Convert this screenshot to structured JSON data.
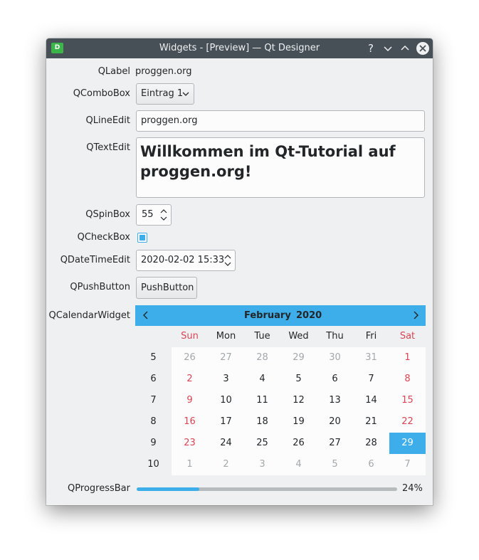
{
  "window": {
    "title": "Widgets - [Preview] — Qt Designer",
    "app_icon_letter": "D",
    "help_glyph": "?",
    "minimize_glyph": "chevron-down-icon",
    "maximize_glyph": "chevron-up-icon",
    "close_glyph": "close-icon"
  },
  "form": {
    "qlabel": {
      "label": "QLabel",
      "value": "proggen.org"
    },
    "qcombobox": {
      "label": "QComboBox",
      "value": "Eintrag 1"
    },
    "qlineedit": {
      "label": "QLineEdit",
      "value": "proggen.org"
    },
    "qtextedit": {
      "label": "QTextEdit",
      "value": "Willkommen im Qt-Tutorial auf proggen.org!"
    },
    "qspinbox": {
      "label": "QSpinBox",
      "value": "55"
    },
    "qcheckbox": {
      "label": "QCheckBox",
      "checked": true
    },
    "qdatetimeedit": {
      "label": "QDateTimeEdit",
      "value": "2020-02-02 15:33"
    },
    "qpushbutton": {
      "label": "QPushButton",
      "button_text": "PushButton"
    },
    "qcalendarwidget": {
      "label": "QCalendarWidget"
    },
    "qprogressbar": {
      "label": "QProgressBar",
      "value": 24,
      "text": "24%"
    }
  },
  "calendar": {
    "month": "February",
    "year": "2020",
    "weekday_headers": [
      "Sun",
      "Mon",
      "Tue",
      "Wed",
      "Thu",
      "Fri",
      "Sat"
    ],
    "weeks": [
      {
        "week": "5",
        "days": [
          "26",
          "27",
          "28",
          "29",
          "30",
          "31",
          "1"
        ],
        "other": [
          true,
          true,
          true,
          true,
          true,
          true,
          false
        ]
      },
      {
        "week": "6",
        "days": [
          "2",
          "3",
          "4",
          "5",
          "6",
          "7",
          "8"
        ],
        "other": [
          false,
          false,
          false,
          false,
          false,
          false,
          false
        ]
      },
      {
        "week": "7",
        "days": [
          "9",
          "10",
          "11",
          "12",
          "13",
          "14",
          "15"
        ],
        "other": [
          false,
          false,
          false,
          false,
          false,
          false,
          false
        ]
      },
      {
        "week": "8",
        "days": [
          "16",
          "17",
          "18",
          "19",
          "20",
          "21",
          "22"
        ],
        "other": [
          false,
          false,
          false,
          false,
          false,
          false,
          false
        ]
      },
      {
        "week": "9",
        "days": [
          "23",
          "24",
          "25",
          "26",
          "27",
          "28",
          "29"
        ],
        "other": [
          false,
          false,
          false,
          false,
          false,
          false,
          false
        ]
      },
      {
        "week": "10",
        "days": [
          "1",
          "2",
          "3",
          "4",
          "5",
          "6",
          "7"
        ],
        "other": [
          true,
          true,
          true,
          true,
          true,
          true,
          true
        ]
      }
    ],
    "selected_day": "29",
    "accent_color": "#3daee9",
    "weekend_color": "#da4453"
  }
}
